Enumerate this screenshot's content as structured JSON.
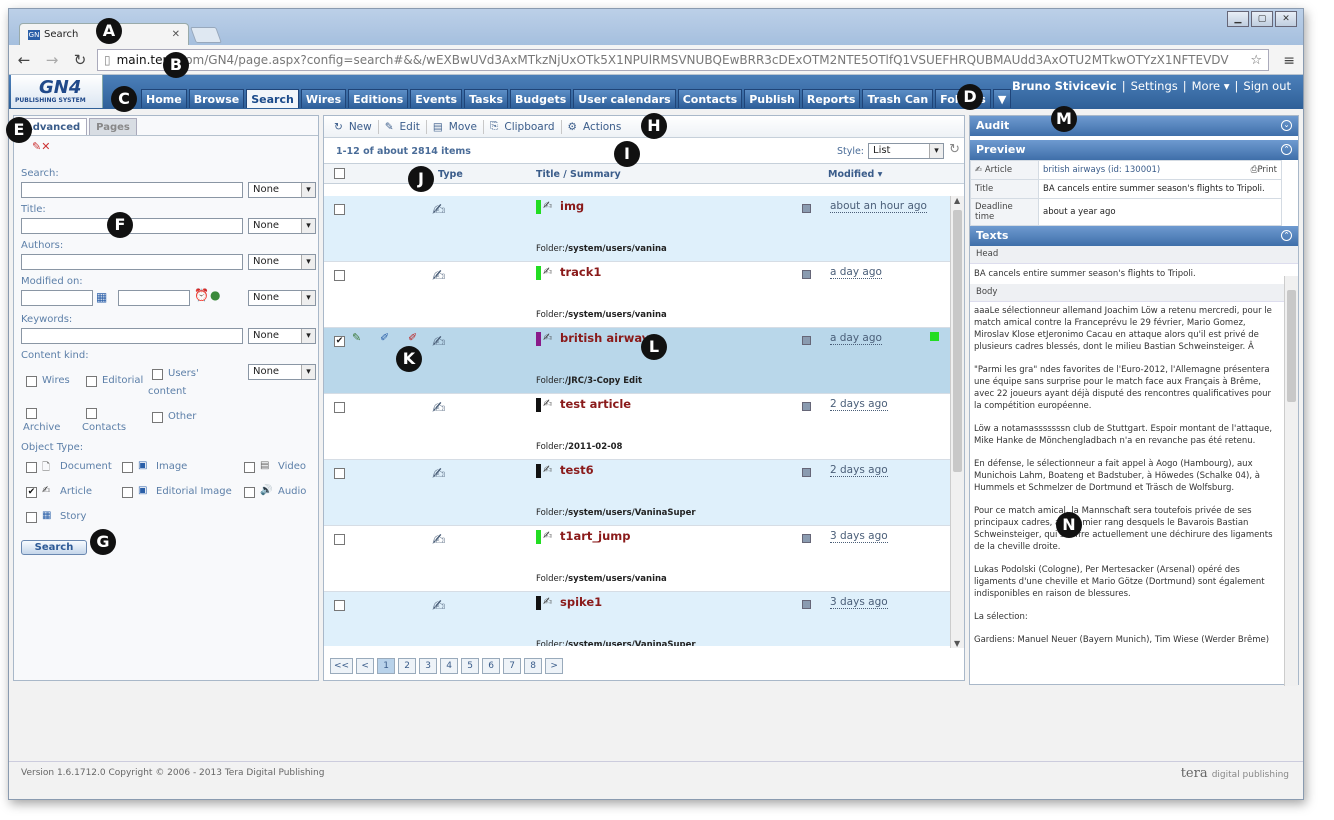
{
  "browser": {
    "tab_title": "Search",
    "url_host": "main.tera",
    "url_rest": ".com/GN4/page.aspx?config=search#&&/wEXBwUVd3AxMTkzNjUxOTk5X1NPUlRMSVNUBQEwBRR3cDExOTM2NTE5OTlfQ1VSUEFHRQUBMAUdd3AxOTU2MTkwOTYzX1NFTEVDV"
  },
  "app": {
    "logo_text": "GN4",
    "logo_sub": "PUBLISHING SYSTEM",
    "nav": [
      "Home",
      "Browse",
      "Search",
      "Wires",
      "Editions",
      "Events",
      "Tasks",
      "Budgets",
      "User calendars",
      "Contacts",
      "Publish",
      "Reports",
      "Trash Can",
      "Folders",
      "▼"
    ],
    "user": {
      "name": "Bruno Stivicevic",
      "settings": "Settings",
      "more": "More ▾",
      "sign_out": "Sign out"
    }
  },
  "search": {
    "tabs": [
      "Advanced",
      "Pages"
    ],
    "search_label": "Search:",
    "title_label": "Title:",
    "authors_label": "Authors:",
    "modified_label": "Modified on:",
    "keywords_label": "Keywords:",
    "none": "None",
    "content_kind_label": "Content kind:",
    "content_kinds": [
      "Wires",
      "Editorial",
      "Users'",
      "content",
      "Archive",
      "Contacts",
      "Other"
    ],
    "object_type_label": "Object Type:",
    "object_types": [
      "Document",
      "Image",
      "Video",
      "Article",
      "Editorial Image",
      "Audio",
      "Story"
    ],
    "search_button": "Search"
  },
  "results": {
    "toolbar": [
      "New",
      "Edit",
      "Move",
      "Clipboard",
      "Actions"
    ],
    "count": "1-12 of about 2814 items",
    "style_label": "Style:",
    "style_value": "List",
    "columns": [
      "Type",
      "Title / Summary",
      "Modified ▾"
    ],
    "folder_label": "Folder:",
    "rows": [
      {
        "title": "img",
        "folder": "/system/users/vanina",
        "modified": "about an hour ago",
        "color": "#22dd22"
      },
      {
        "title": "track1",
        "folder": "/system/users/vanina",
        "modified": "a day ago",
        "color": "#22dd22"
      },
      {
        "title": "british airways",
        "folder": "/JRC/3-Copy Edit",
        "modified": "a day ago",
        "color": "#8a1a8a"
      },
      {
        "title": "test article",
        "folder": "/2011-02-08",
        "modified": "2 days ago",
        "color": "#111111"
      },
      {
        "title": "test6",
        "folder": "/system/users/VaninaSuper",
        "modified": "2 days ago",
        "color": "#111111"
      },
      {
        "title": "t1art_jump",
        "folder": "/system/users/vanina",
        "modified": "3 days ago",
        "color": "#22dd22"
      },
      {
        "title": "spike1",
        "folder": "/system/users/VaninaSuper",
        "modified": "3 days ago",
        "color": "#111111"
      }
    ],
    "pager": [
      "<<",
      "<",
      "1",
      "2",
      "3",
      "4",
      "5",
      "6",
      "7",
      "8",
      ">"
    ]
  },
  "right": {
    "audit": "Audit",
    "preview": "Preview",
    "article_label": "Article",
    "article_value": "british airways (id: 130001)",
    "print": "Print",
    "title_key": "Title",
    "title_value": "BA cancels entire summer season's flights to Tripoli.",
    "deadline_key": "Deadline time",
    "deadline_value": "about a year ago",
    "texts": "Texts",
    "head_label": "Head",
    "head_text": "BA cancels entire summer season's flights to Tripoli.",
    "body_label": "Body",
    "paras": [
      "aaaLe sélectionneur allemand Joachim Löw a retenu mercredi, pour le match amical contre la Franceprévu le 29 février, Mario Gomez, Miroslav Klose etJeronimo Cacau en attaque alors qu'il est privé de plusieurs cadres blessés, dont le milieu Bastian Schweinsteiger. Â",
      "\"Parmi les gra\" ndes favorites de l'Euro-2012, l'Allemagne présentera une équipe sans surprise pour le match face aux Français à Brême, avec 22 joueurs ayant déjà disputé des rencontres qualificatives pour la compétition européenne.",
      "Löw a notamasssssssn club de Stuttgart. Espoir montant de l'attaque, Mike Hanke de Mönchengladbach n'a en revanche pas été retenu.",
      "En défense, le sélectionneur a fait appel à Aogo (Hambourg), aux Munichois Lahm, Boateng et Badstuber, à Höwedes (Schalke 04), à Hummels et Schmelzer de Dortmund et Träsch de Wolfsburg.",
      "Pour ce match amical, la Mannschaft sera toutefois privée de ses principaux cadres, au premier rang desquels le Bavarois Bastian Schweinsteiger, qui souffre actuellement une déchirure des ligaments de la cheville droite.",
      "Lukas Podolski (Cologne), Per Mertesacker (Arsenal) opéré des ligaments d'une cheville et Mario Götze (Dortmund) sont également indisponibles en raison de blessures.",
      "La sélection:",
      "Gardiens: Manuel Neuer (Bayern Munich), Tim Wiese (Werder Brême)"
    ]
  },
  "footer": {
    "version": "Version 1.6.1712.0 Copyright © 2006 - 2013 Tera Digital Publishing",
    "brand": "tera",
    "brand_sub": "digital publishing"
  },
  "markers": [
    "A",
    "B",
    "C",
    "D",
    "E",
    "F",
    "G",
    "H",
    "I",
    "J",
    "K",
    "L",
    "M",
    "N"
  ]
}
